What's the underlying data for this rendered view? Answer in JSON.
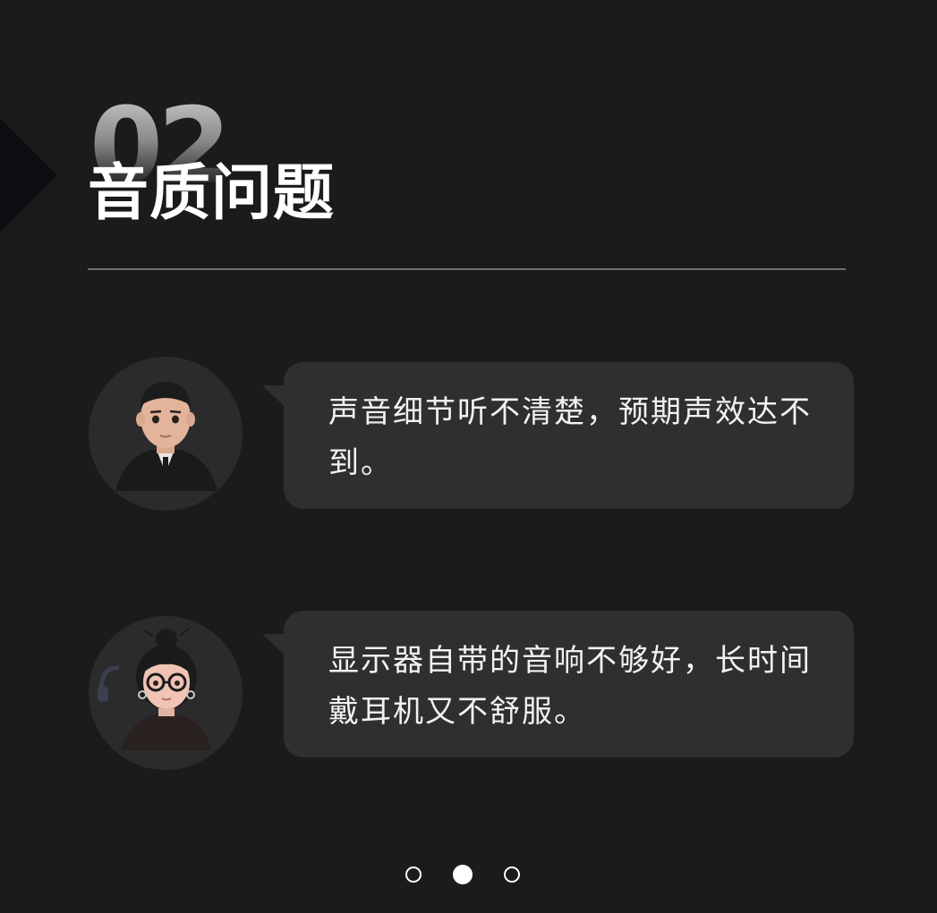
{
  "section": {
    "number": "02",
    "title": "音质问题"
  },
  "comments": [
    {
      "avatar": "male-3d-avatar",
      "text": "声音细节听不清楚，预期声效达不到。"
    },
    {
      "avatar": "female-3d-avatar-with-glasses",
      "text": "显示器自带的音响不够好，长时间戴耳机又不舒服。"
    }
  ],
  "pager": {
    "total": 3,
    "active_index": 1
  },
  "colors": {
    "background": "#1b1b1c",
    "bubble": "#2f2f31",
    "avatar_bg": "#2b2b2d",
    "divider": "#6f6f72",
    "text": "#ffffff"
  }
}
